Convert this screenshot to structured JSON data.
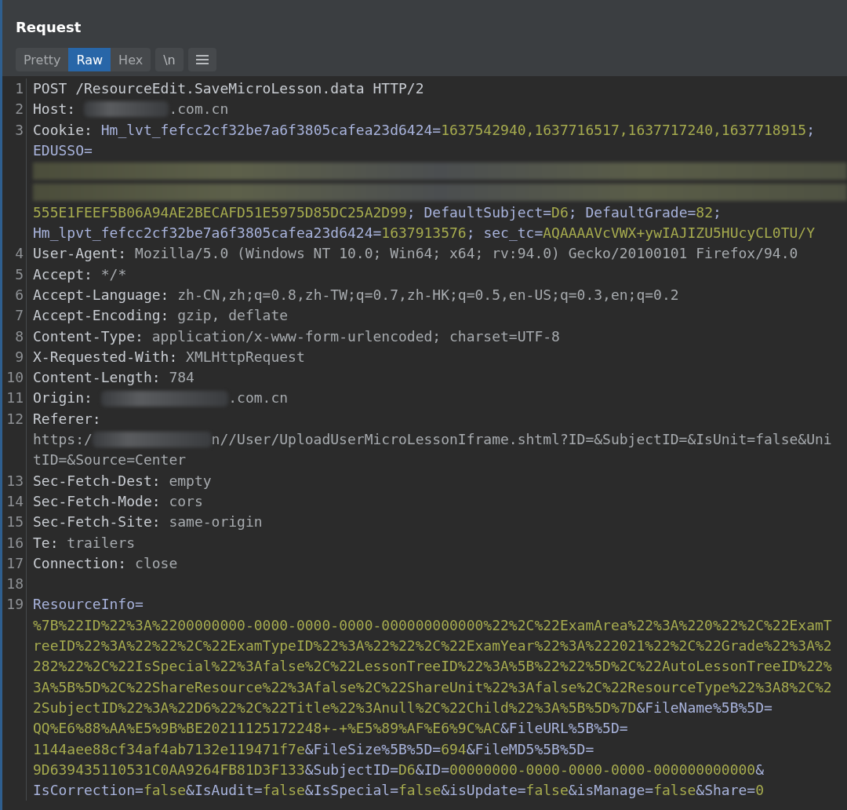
{
  "panel": {
    "title": "Request"
  },
  "tabs": [
    {
      "label": "Pretty",
      "selected": false
    },
    {
      "label": "Raw",
      "selected": true
    },
    {
      "label": "Hex",
      "selected": false
    }
  ],
  "toolbar": {
    "newline_button": "\\n"
  },
  "lines": [
    {
      "number": "1",
      "rows": [
        {
          "segments": [
            {
              "kind": "name",
              "text": "POST /ResourceEdit.SaveMicroLesson.data HTTP/2"
            }
          ]
        }
      ]
    },
    {
      "number": "2",
      "rows": [
        {
          "segments": [
            {
              "kind": "name",
              "text": "Host: "
            },
            {
              "kind": "blur"
            },
            {
              "kind": "value",
              "text": ".com.cn"
            }
          ]
        }
      ]
    },
    {
      "number": "3",
      "rows": [
        {
          "segments": [
            {
              "kind": "name",
              "text": "Cookie: "
            },
            {
              "kind": "pname",
              "text": "Hm_lvt_fefcc2cf32be7a6f3805cafea23d6424="
            },
            {
              "kind": "pval",
              "text": "1637542940,1637716517,1637717240,1637718915"
            },
            {
              "kind": "pname",
              "text": ";"
            }
          ]
        },
        {
          "segments": [
            {
              "kind": "pname",
              "text": "EDUSSO="
            }
          ]
        },
        {
          "segments": [
            {
              "kind": "blur-row"
            }
          ]
        },
        {
          "segments": [
            {
              "kind": "blur-row"
            }
          ]
        },
        {
          "segments": [
            {
              "kind": "pval",
              "text": "555E1FEEF5B06A94AE2BECAFD51E5975D85DC25A2D99"
            },
            {
              "kind": "pname",
              "text": "; DefaultSubject="
            },
            {
              "kind": "pval",
              "text": "D6"
            },
            {
              "kind": "pname",
              "text": "; DefaultGrade="
            },
            {
              "kind": "pval",
              "text": "82"
            },
            {
              "kind": "pname",
              "text": ";"
            }
          ]
        },
        {
          "segments": [
            {
              "kind": "pname",
              "text": "Hm_lpvt_fefcc2cf32be7a6f3805cafea23d6424="
            },
            {
              "kind": "pval",
              "text": "1637913576"
            },
            {
              "kind": "pname",
              "text": "; sec_tc="
            },
            {
              "kind": "pval",
              "text": "AQAAAAVcVWX+ywIAJIZU5HUcyCL0TU/Y"
            }
          ]
        }
      ]
    },
    {
      "number": "4",
      "rows": [
        {
          "segments": [
            {
              "kind": "name",
              "text": "User-Agent: "
            },
            {
              "kind": "value",
              "text": "Mozilla/5.0 (Windows NT 10.0; Win64; x64; rv:94.0) Gecko/20100101 Firefox/94.0"
            }
          ]
        }
      ]
    },
    {
      "number": "5",
      "rows": [
        {
          "segments": [
            {
              "kind": "name",
              "text": "Accept: "
            },
            {
              "kind": "value",
              "text": "*/*"
            }
          ]
        }
      ]
    },
    {
      "number": "6",
      "rows": [
        {
          "segments": [
            {
              "kind": "name",
              "text": "Accept-Language: "
            },
            {
              "kind": "value",
              "text": "zh-CN,zh;q=0.8,zh-TW;q=0.7,zh-HK;q=0.5,en-US;q=0.3,en;q=0.2"
            }
          ]
        }
      ]
    },
    {
      "number": "7",
      "rows": [
        {
          "segments": [
            {
              "kind": "name",
              "text": "Accept-Encoding: "
            },
            {
              "kind": "value",
              "text": "gzip, deflate"
            }
          ]
        }
      ]
    },
    {
      "number": "8",
      "rows": [
        {
          "segments": [
            {
              "kind": "name",
              "text": "Content-Type: "
            },
            {
              "kind": "value",
              "text": "application/x-www-form-urlencoded; charset=UTF-8"
            }
          ]
        }
      ]
    },
    {
      "number": "9",
      "rows": [
        {
          "segments": [
            {
              "kind": "name",
              "text": "X-Requested-With: "
            },
            {
              "kind": "value",
              "text": "XMLHttpRequest"
            }
          ]
        }
      ]
    },
    {
      "number": "10",
      "rows": [
        {
          "segments": [
            {
              "kind": "name",
              "text": "Content-Length: "
            },
            {
              "kind": "value",
              "text": "784"
            }
          ]
        }
      ]
    },
    {
      "number": "11",
      "rows": [
        {
          "segments": [
            {
              "kind": "name",
              "text": "Origin: "
            },
            {
              "kind": "blur"
            },
            {
              "kind": "value",
              "text": ".com.cn"
            }
          ]
        }
      ]
    },
    {
      "number": "12",
      "rows": [
        {
          "segments": [
            {
              "kind": "name",
              "text": "Referer: "
            }
          ]
        },
        {
          "segments": [
            {
              "kind": "value",
              "text": "https:/"
            },
            {
              "kind": "blur"
            },
            {
              "kind": "value",
              "text": "n//User/UploadUserMicroLessonIframe.shtml?ID=&SubjectID=&IsUnit=false&Uni"
            }
          ]
        },
        {
          "segments": [
            {
              "kind": "value",
              "text": "tID=&Source=Center"
            }
          ]
        }
      ]
    },
    {
      "number": "13",
      "rows": [
        {
          "segments": [
            {
              "kind": "name",
              "text": "Sec-Fetch-Dest: "
            },
            {
              "kind": "value",
              "text": "empty"
            }
          ]
        }
      ]
    },
    {
      "number": "14",
      "rows": [
        {
          "segments": [
            {
              "kind": "name",
              "text": "Sec-Fetch-Mode: "
            },
            {
              "kind": "value",
              "text": "cors"
            }
          ]
        }
      ]
    },
    {
      "number": "15",
      "rows": [
        {
          "segments": [
            {
              "kind": "name",
              "text": "Sec-Fetch-Site: "
            },
            {
              "kind": "value",
              "text": "same-origin"
            }
          ]
        }
      ]
    },
    {
      "number": "16",
      "rows": [
        {
          "segments": [
            {
              "kind": "name",
              "text": "Te: "
            },
            {
              "kind": "value",
              "text": "trailers"
            }
          ]
        }
      ]
    },
    {
      "number": "17",
      "rows": [
        {
          "segments": [
            {
              "kind": "name",
              "text": "Connection: "
            },
            {
              "kind": "value",
              "text": "close"
            }
          ]
        }
      ]
    },
    {
      "number": "18"
    },
    {
      "number": "19",
      "rows": [
        {
          "segments": [
            {
              "kind": "pname",
              "text": "ResourceInfo="
            }
          ]
        },
        {
          "segments": [
            {
              "kind": "pval",
              "text": "%7B%22ID%22%3A%2200000000-0000-0000-0000-000000000000%22%2C%22ExamArea%22%3A%220%22%2C%22ExamT"
            }
          ]
        },
        {
          "segments": [
            {
              "kind": "pval",
              "text": "reeID%22%3A%22%22%2C%22ExamTypeID%22%3A%22%22%2C%22ExamYear%22%3A%222021%22%2C%22Grade%22%3A%2"
            }
          ]
        },
        {
          "segments": [
            {
              "kind": "pval",
              "text": "282%22%2C%22IsSpecial%22%3Afalse%2C%22LessonTreeID%22%3A%5B%22%22%5D%2C%22AutoLessonTreeID%22%"
            }
          ]
        },
        {
          "segments": [
            {
              "kind": "pval",
              "text": "3A%5B%5D%2C%22ShareResource%22%3Afalse%2C%22ShareUnit%22%3Afalse%2C%22ResourceType%22%3A8%2C%2"
            }
          ]
        },
        {
          "segments": [
            {
              "kind": "pval",
              "text": "2SubjectID%22%3A%22D6%22%2C%22Title%22%3Anull%2C%22Child%22%3A%5B%5D%7D"
            },
            {
              "kind": "pname",
              "text": "&FileName%5B%5D="
            }
          ]
        },
        {
          "segments": [
            {
              "kind": "pval",
              "text": "QQ%E6%88%AA%E5%9B%BE20211125172248+-+%E5%89%AF%E6%9C%AC"
            },
            {
              "kind": "pname",
              "text": "&FileURL%5B%5D="
            }
          ]
        },
        {
          "segments": [
            {
              "kind": "pval",
              "text": "1144aee88cf34af4ab7132e119471f7e"
            },
            {
              "kind": "pname",
              "text": "&FileSize%5B%5D="
            },
            {
              "kind": "pval",
              "text": "694"
            },
            {
              "kind": "pname",
              "text": "&FileMD5%5B%5D="
            }
          ]
        },
        {
          "segments": [
            {
              "kind": "pval",
              "text": "9D639435110531C0AA9264FB81D3F133"
            },
            {
              "kind": "pname",
              "text": "&SubjectID="
            },
            {
              "kind": "pval",
              "text": "D6"
            },
            {
              "kind": "pname",
              "text": "&ID="
            },
            {
              "kind": "pval",
              "text": "00000000-0000-0000-0000-000000000000"
            },
            {
              "kind": "pname",
              "text": "&"
            }
          ]
        },
        {
          "segments": [
            {
              "kind": "pname",
              "text": "IsCorrection="
            },
            {
              "kind": "pval",
              "text": "false"
            },
            {
              "kind": "pname",
              "text": "&IsAudit="
            },
            {
              "kind": "pval",
              "text": "false"
            },
            {
              "kind": "pname",
              "text": "&IsSpecial="
            },
            {
              "kind": "pval",
              "text": "false"
            },
            {
              "kind": "pname",
              "text": "&isUpdate="
            },
            {
              "kind": "pval",
              "text": "false"
            },
            {
              "kind": "pname",
              "text": "&isManage="
            },
            {
              "kind": "pval",
              "text": "false"
            },
            {
              "kind": "pname",
              "text": "&Share="
            },
            {
              "kind": "pval",
              "text": "0"
            }
          ]
        }
      ]
    }
  ]
}
